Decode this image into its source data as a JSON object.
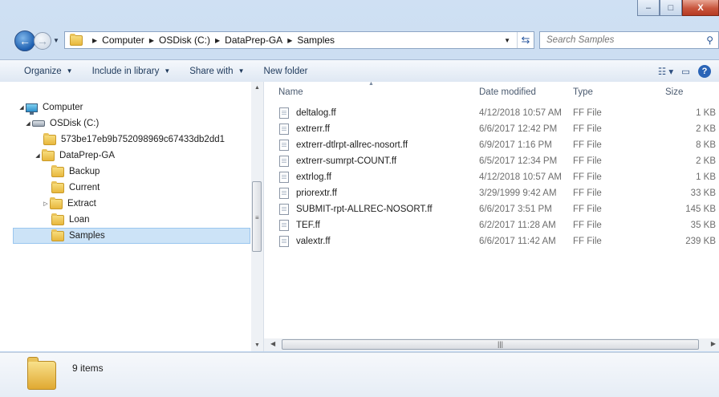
{
  "window": {
    "controls": {
      "minimize": "–",
      "maximize": "□",
      "close": "X"
    }
  },
  "address": {
    "back_glyph": "←",
    "forward_glyph": "→",
    "breadcrumbs": [
      "Computer",
      "OSDisk (C:)",
      "DataPrep-GA",
      "Samples"
    ],
    "search_placeholder": "Search Samples"
  },
  "toolbar": {
    "organize": "Organize",
    "include_in_library": "Include in library",
    "share_with": "Share with",
    "new_folder": "New folder"
  },
  "tree": {
    "computer": "Computer",
    "osdisk": "OSDisk (C:)",
    "hash_folder": "573be17eb9b752098969c67433db2dd1",
    "dataprep": "DataPrep-GA",
    "backup": "Backup",
    "current": "Current",
    "extract": "Extract",
    "loan": "Loan",
    "samples": "Samples"
  },
  "columns": {
    "name": "Name",
    "date_modified": "Date modified",
    "type": "Type",
    "size": "Size"
  },
  "files": [
    {
      "name": "deltalog.ff",
      "date": "4/12/2018 10:57 AM",
      "type": "FF File",
      "size": "1 KB"
    },
    {
      "name": "extrerr.ff",
      "date": "6/6/2017 12:42 PM",
      "type": "FF File",
      "size": "2 KB"
    },
    {
      "name": "extrerr-dtlrpt-allrec-nosort.ff",
      "date": "6/9/2017 1:16 PM",
      "type": "FF File",
      "size": "8 KB"
    },
    {
      "name": "extrerr-sumrpt-COUNT.ff",
      "date": "6/5/2017 12:34 PM",
      "type": "FF File",
      "size": "2 KB"
    },
    {
      "name": "extrlog.ff",
      "date": "4/12/2018 10:57 AM",
      "type": "FF File",
      "size": "1 KB"
    },
    {
      "name": "priorextr.ff",
      "date": "3/29/1999 9:42 AM",
      "type": "FF File",
      "size": "33 KB"
    },
    {
      "name": "SUBMIT-rpt-ALLREC-NOSORT.ff",
      "date": "6/6/2017 3:51 PM",
      "type": "FF File",
      "size": "145 KB"
    },
    {
      "name": "TEF.ff",
      "date": "6/2/2017 11:28 AM",
      "type": "FF File",
      "size": "35 KB"
    },
    {
      "name": "valextr.ff",
      "date": "6/6/2017 11:42 AM",
      "type": "FF File",
      "size": "239 KB"
    }
  ],
  "status": {
    "item_count": "9 items"
  }
}
